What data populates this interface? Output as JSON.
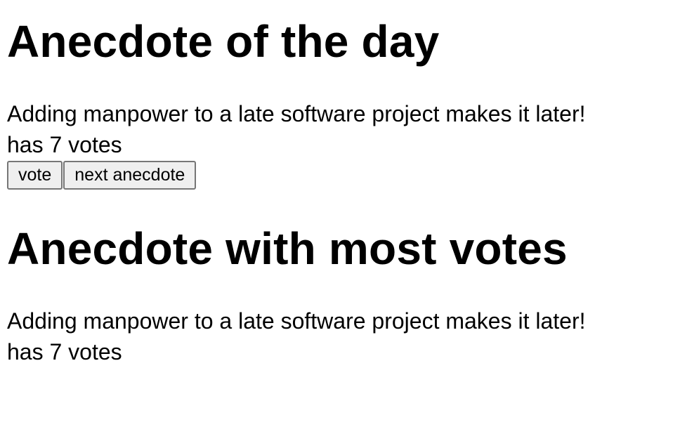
{
  "anecdote_of_the_day": {
    "heading": "Anecdote of the day",
    "text": "Adding manpower to a late software project makes it later!",
    "votes_text": "has 7 votes",
    "vote_button_label": "vote",
    "next_button_label": "next anecdote"
  },
  "most_votes": {
    "heading": "Anecdote with most votes",
    "text": "Adding manpower to a late software project makes it later!",
    "votes_text": "has 7 votes"
  }
}
